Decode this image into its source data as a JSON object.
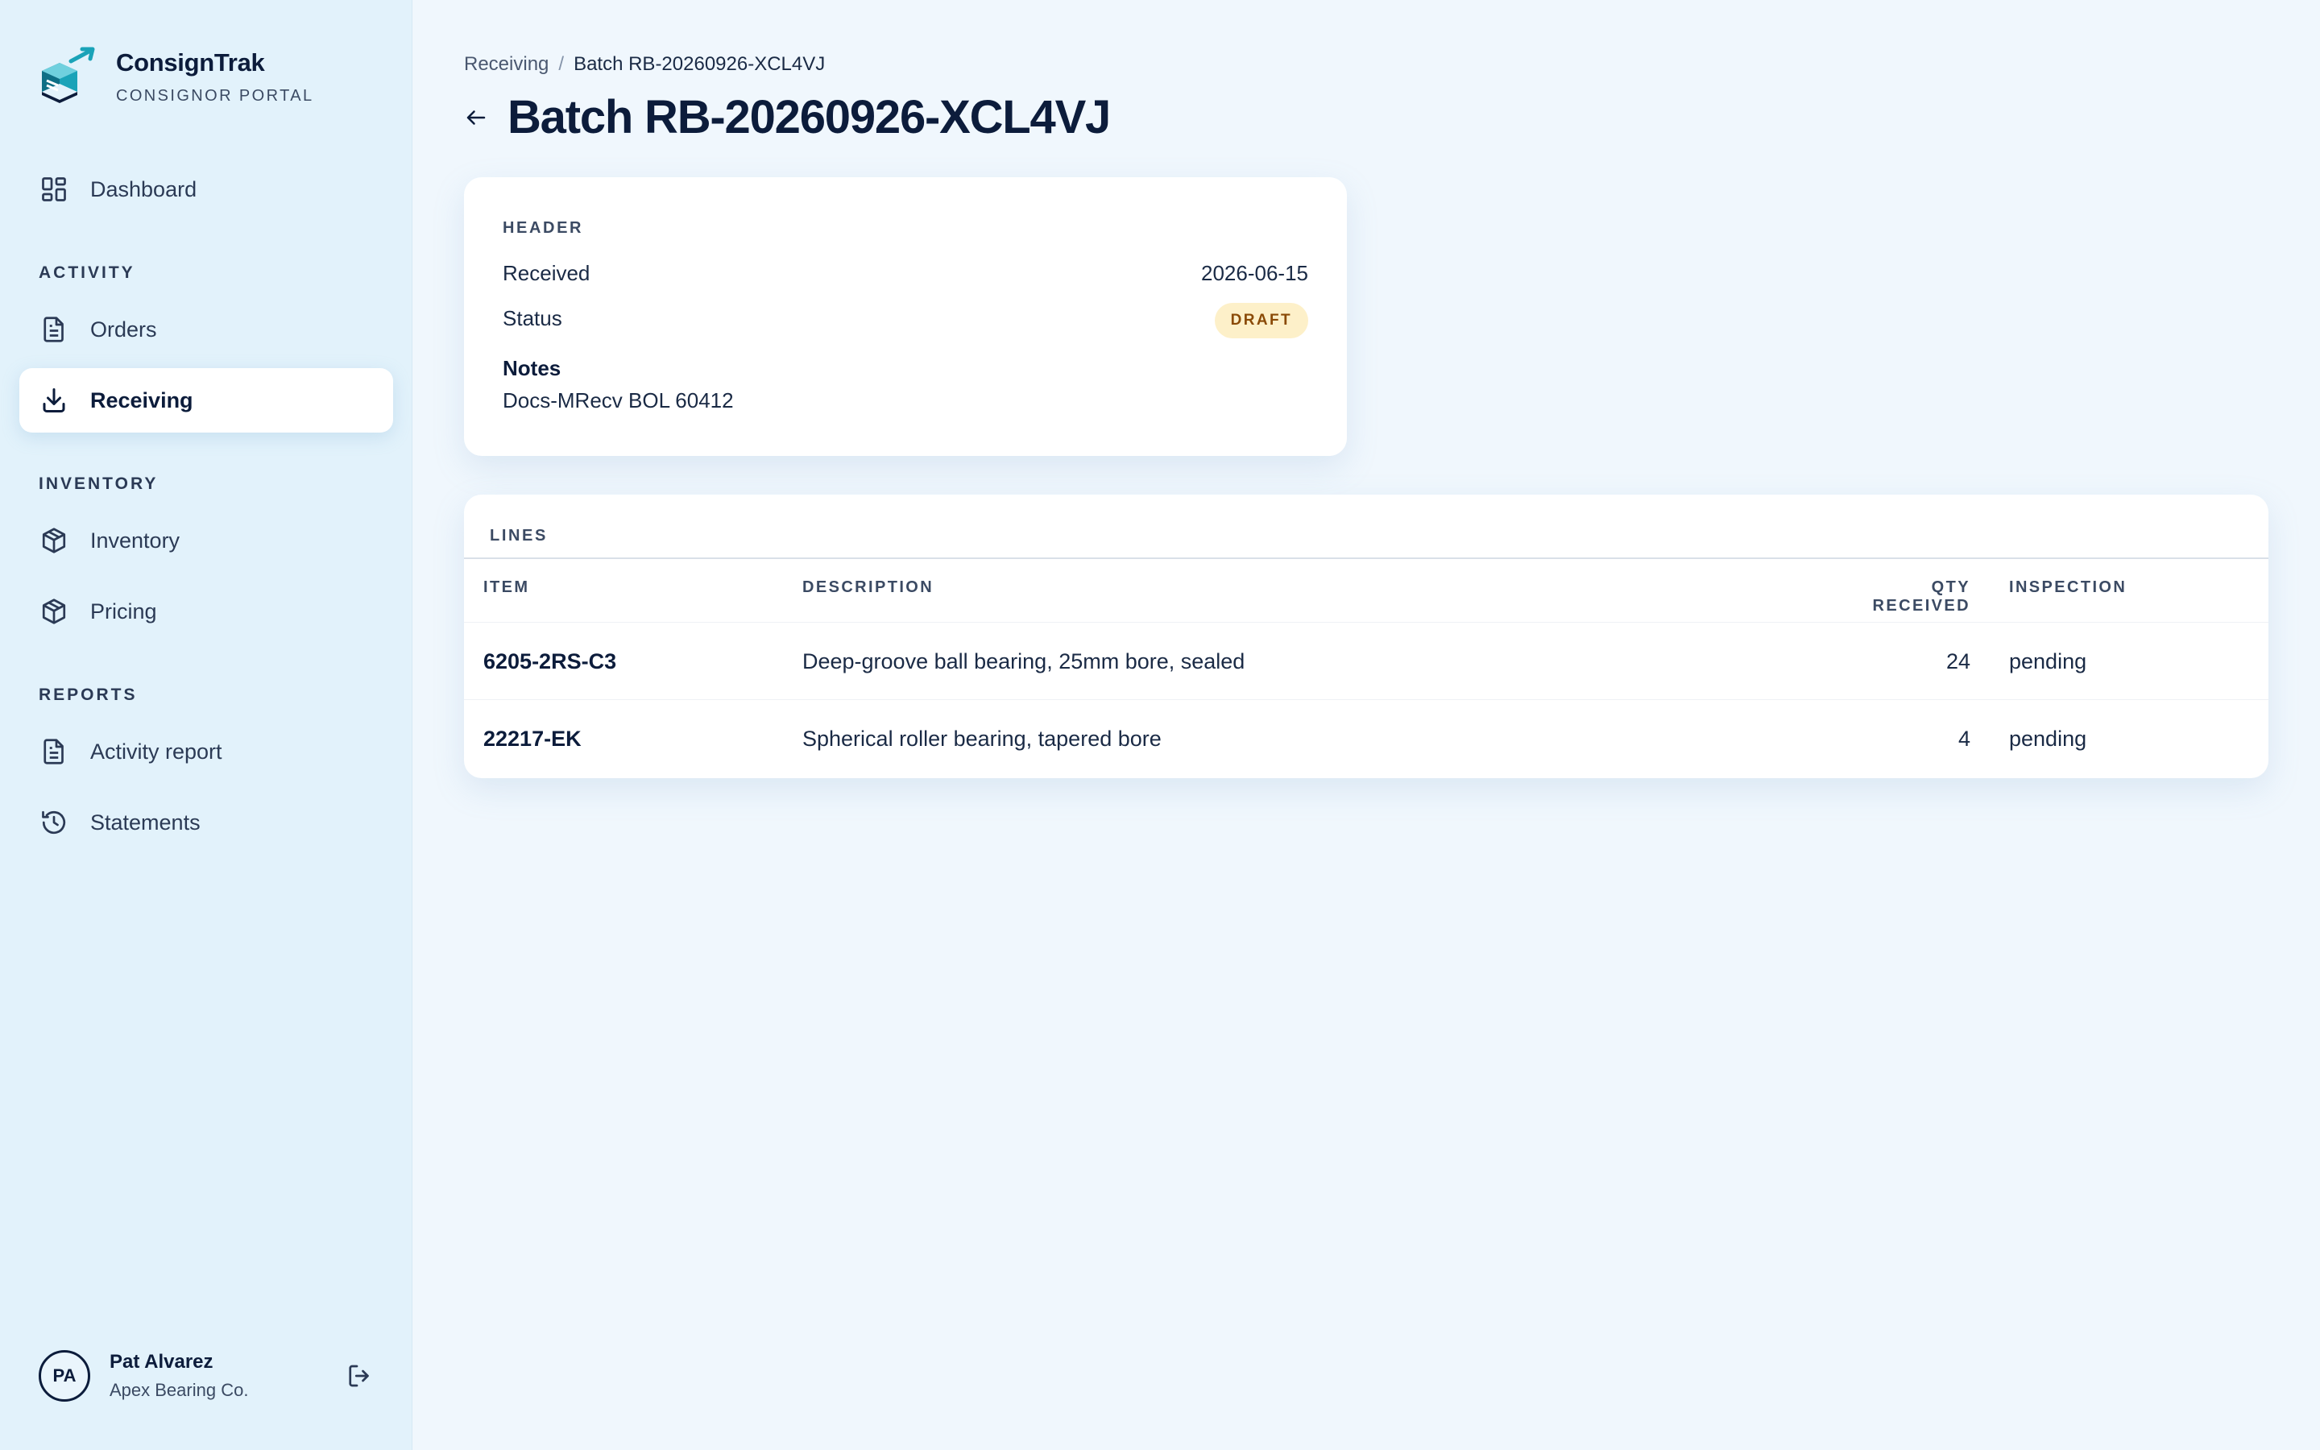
{
  "brand": {
    "name": "ConsignTrak",
    "subtitle": "CONSIGNOR PORTAL"
  },
  "sidebar": {
    "dashboard": "Dashboard",
    "section_activity": "ACTIVITY",
    "orders": "Orders",
    "receiving": "Receiving",
    "section_inventory": "INVENTORY",
    "inventory": "Inventory",
    "pricing": "Pricing",
    "section_reports": "REPORTS",
    "activity_report": "Activity report",
    "statements": "Statements",
    "active_item": "Receiving"
  },
  "user": {
    "initials": "PA",
    "name": "Pat Alvarez",
    "org": "Apex Bearing Co."
  },
  "breadcrumb": {
    "parent": "Receiving",
    "separator": "/",
    "current": "Batch RB-20260926-XCL4VJ"
  },
  "page": {
    "title": "Batch RB-20260926-XCL4VJ"
  },
  "header_card": {
    "label": "HEADER",
    "received_label": "Received",
    "received_value": "2026-06-15",
    "status_label": "Status",
    "status_value": "DRAFT",
    "notes_label": "Notes",
    "notes_value": "Docs-MRecv BOL 60412"
  },
  "lines": {
    "label": "LINES",
    "columns": {
      "item": "ITEM",
      "description": "DESCRIPTION",
      "qty": "QTY RECEIVED",
      "inspection": "INSPECTION"
    },
    "rows": [
      {
        "item": "6205-2RS-C3",
        "description": "Deep-groove ball bearing, 25mm bore, sealed",
        "qty": "24",
        "inspection": "pending"
      },
      {
        "item": "22217-EK",
        "description": "Spherical roller bearing, tapered bore",
        "qty": "4",
        "inspection": "pending"
      }
    ]
  },
  "colors": {
    "accent": "#1aa3b8",
    "navy": "#0c1c3b",
    "badge_bg": "#fdf0c9",
    "badge_text": "#8a4a06",
    "sidebar_bg": "#e2f2fb",
    "main_bg": "#f0f7fd"
  }
}
